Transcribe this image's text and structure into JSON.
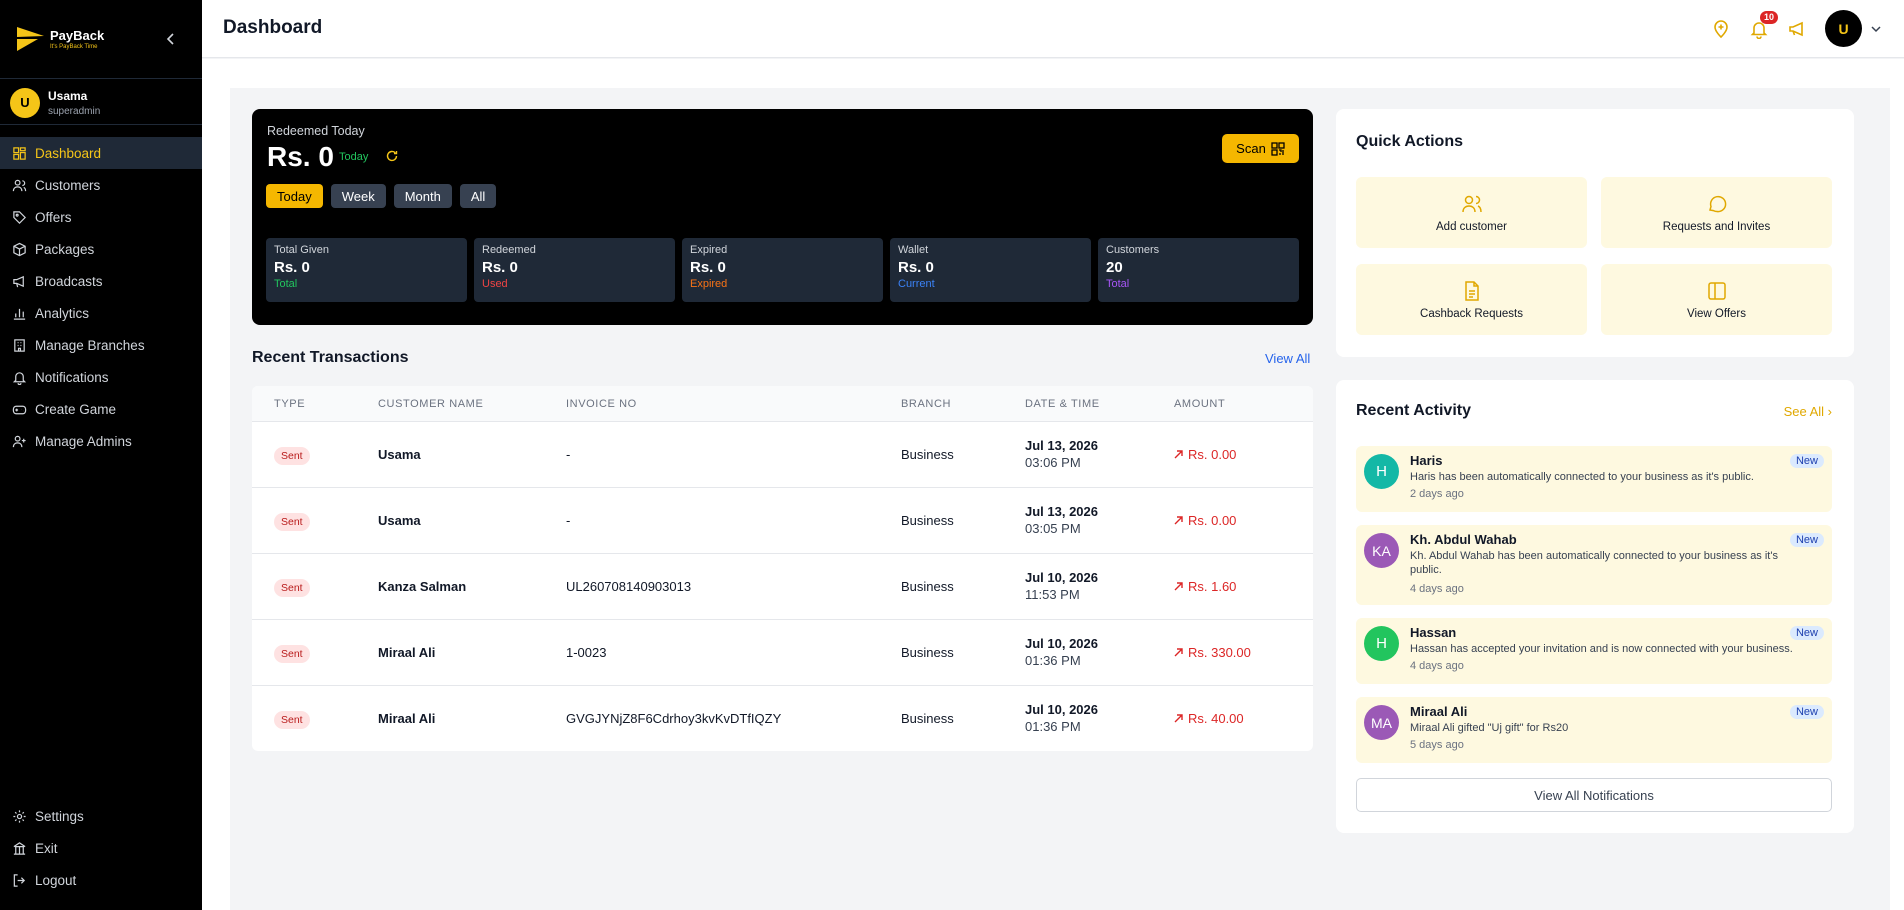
{
  "brand": {
    "name": "PayBack",
    "tagline": "It's PayBack Time"
  },
  "user": {
    "initial": "U",
    "name": "Usama",
    "role": "superadmin"
  },
  "nav": [
    {
      "label": "Dashboard",
      "icon": "grid-icon"
    },
    {
      "label": "Customers",
      "icon": "users-icon"
    },
    {
      "label": "Offers",
      "icon": "tag-icon"
    },
    {
      "label": "Packages",
      "icon": "box-icon"
    },
    {
      "label": "Broadcasts",
      "icon": "megaphone-icon"
    },
    {
      "label": "Analytics",
      "icon": "bar-chart-icon"
    },
    {
      "label": "Manage Branches",
      "icon": "building-icon"
    },
    {
      "label": "Notifications",
      "icon": "bell-icon"
    },
    {
      "label": "Create Game",
      "icon": "gamepad-icon"
    },
    {
      "label": "Manage Admins",
      "icon": "user-plus-icon"
    }
  ],
  "nav_bottom": [
    {
      "label": "Settings",
      "icon": "gear-icon"
    },
    {
      "label": "Exit",
      "icon": "bank-icon"
    },
    {
      "label": "Logout",
      "icon": "logout-icon"
    }
  ],
  "header": {
    "title": "Dashboard",
    "notification_count": "10",
    "avatar_initial": "U"
  },
  "hero": {
    "label": "Redeemed Today",
    "amount": "Rs. 0",
    "period": "Today",
    "scan_label": "Scan",
    "filters": [
      "Today",
      "Week",
      "Month",
      "All"
    ],
    "stats": [
      {
        "label": "Total Given",
        "value": "Rs. 0",
        "sub": "Total",
        "color": "#22c55e"
      },
      {
        "label": "Redeemed",
        "value": "Rs. 0",
        "sub": "Used",
        "color": "#ef4444"
      },
      {
        "label": "Expired",
        "value": "Rs. 0",
        "sub": "Expired",
        "color": "#f97316"
      },
      {
        "label": "Wallet",
        "value": "Rs. 0",
        "sub": "Current",
        "color": "#3b82f6"
      },
      {
        "label": "Customers",
        "value": "20",
        "sub": "Total",
        "color": "#a855f7"
      }
    ]
  },
  "transactions": {
    "title": "Recent Transactions",
    "view_all": "View All",
    "columns": [
      "TYPE",
      "CUSTOMER NAME",
      "INVOICE NO",
      "BRANCH",
      "DATE & TIME",
      "AMOUNT"
    ],
    "rows": [
      {
        "type": "Sent",
        "customer": "Usama",
        "invoice": "-",
        "branch": "Business",
        "date": "Jul 13, 2026",
        "time": "03:06 PM",
        "amount": "Rs. 0.00"
      },
      {
        "type": "Sent",
        "customer": "Usama",
        "invoice": "-",
        "branch": "Business",
        "date": "Jul 13, 2026",
        "time": "03:05 PM",
        "amount": "Rs. 0.00"
      },
      {
        "type": "Sent",
        "customer": "Kanza Salman",
        "invoice": "UL260708140903013",
        "branch": "Business",
        "date": "Jul 10, 2026",
        "time": "11:53 PM",
        "amount": "Rs. 1.60"
      },
      {
        "type": "Sent",
        "customer": "Miraal Ali",
        "invoice": "1-0023",
        "branch": "Business",
        "date": "Jul 10, 2026",
        "time": "01:36 PM",
        "amount": "Rs. 330.00"
      },
      {
        "type": "Sent",
        "customer": "Miraal Ali",
        "invoice": "GVGJYNjZ8F6Cdrhoy3kvKvDTfIQZY",
        "branch": "Business",
        "date": "Jul 10, 2026",
        "time": "01:36 PM",
        "amount": "Rs. 40.00"
      }
    ]
  },
  "quick_actions": {
    "title": "Quick Actions",
    "items": [
      {
        "label": "Add customer",
        "icon": "users-icon"
      },
      {
        "label": "Requests and Invites",
        "icon": "chat-bubble-icon"
      },
      {
        "label": "Cashback Requests",
        "icon": "document-icon"
      },
      {
        "label": "View Offers",
        "icon": "layout-icon"
      }
    ]
  },
  "activity": {
    "title": "Recent Activity",
    "see_all": "See All ›",
    "items": [
      {
        "initials": "H",
        "name": "Haris",
        "message": "Haris has been automatically connected to your business as it's public.",
        "time": "2 days ago",
        "badge": "New",
        "color": "#14b8a6"
      },
      {
        "initials": "KA",
        "name": "Kh. Abdul Wahab",
        "message": "Kh. Abdul Wahab has been automatically connected to your business as it's public.",
        "time": "4 days ago",
        "badge": "New",
        "color": "#9b59b6"
      },
      {
        "initials": "H",
        "name": "Hassan",
        "message": "Hassan has accepted your invitation and is now connected with your business.",
        "time": "4 days ago",
        "badge": "New",
        "color": "#22c55e"
      },
      {
        "initials": "MA",
        "name": "Miraal Ali",
        "message": "Miraal Ali gifted \"Uj gift\" for Rs20",
        "time": "5 days ago",
        "badge": "New",
        "color": "#9b59b6"
      }
    ],
    "view_all_label": "View All Notifications"
  },
  "colors": {
    "accent": "#f5b700",
    "sidebar_bg": "#000000",
    "danger": "#dc2626"
  }
}
